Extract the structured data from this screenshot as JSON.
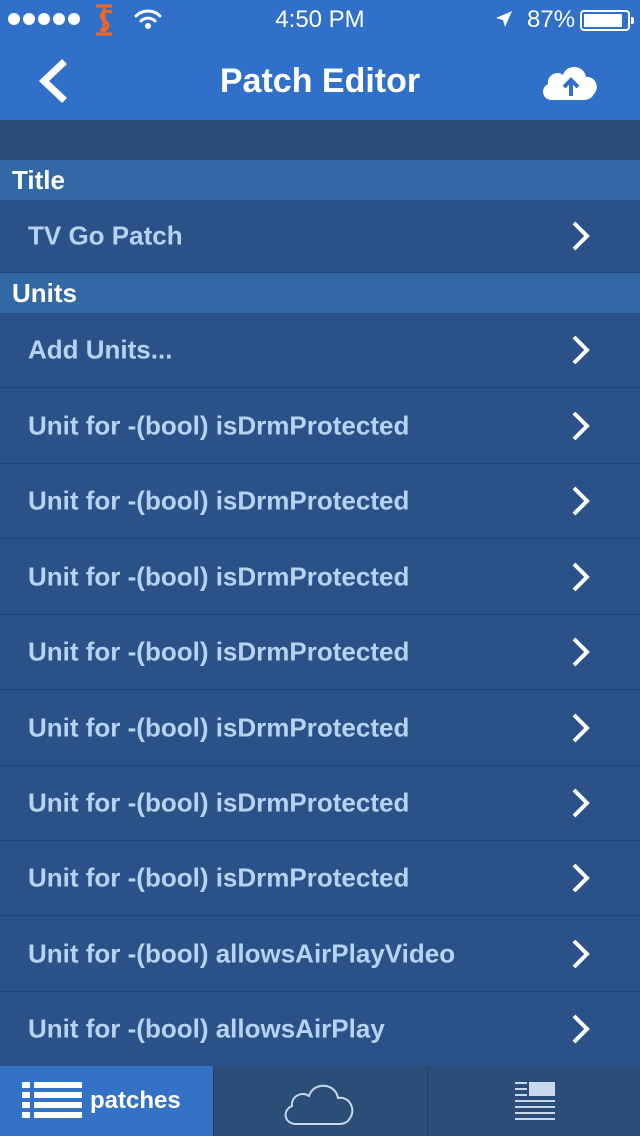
{
  "status_bar": {
    "time": "4:50 PM",
    "battery_percent": "87%",
    "carrier_logo": "SF",
    "battery_level": 0.87
  },
  "nav": {
    "title": "Patch Editor",
    "back_icon": "chevron-left-icon",
    "upload_icon": "cloud-upload-icon"
  },
  "sections": {
    "title_header": "Title",
    "title_value": "TV Go Patch",
    "units_header": "Units",
    "units_items": [
      "Add Units...",
      "Unit for -(bool) isDrmProtected",
      "Unit for -(bool) isDrmProtected",
      "Unit for -(bool) isDrmProtected",
      "Unit for -(bool) isDrmProtected",
      "Unit for -(bool) isDrmProtected",
      "Unit for -(bool) isDrmProtected",
      "Unit for -(bool) isDrmProtected",
      "Unit for -(bool) allowsAirPlayVideo",
      "Unit for -(bool) allowsAirPlay"
    ]
  },
  "tabbar": {
    "tabs": [
      {
        "label": "patches",
        "icon": "list-icon",
        "active": true
      },
      {
        "label": "",
        "icon": "cloud-icon",
        "active": false
      },
      {
        "label": "",
        "icon": "document-icon",
        "active": false
      }
    ]
  },
  "colors": {
    "nav_blue": "#3070c8",
    "row_bg": "#2a5288",
    "section_header_bg": "#3268a4",
    "row_text": "#b7d3f2",
    "tabbar_bg": "#2b4e78"
  }
}
